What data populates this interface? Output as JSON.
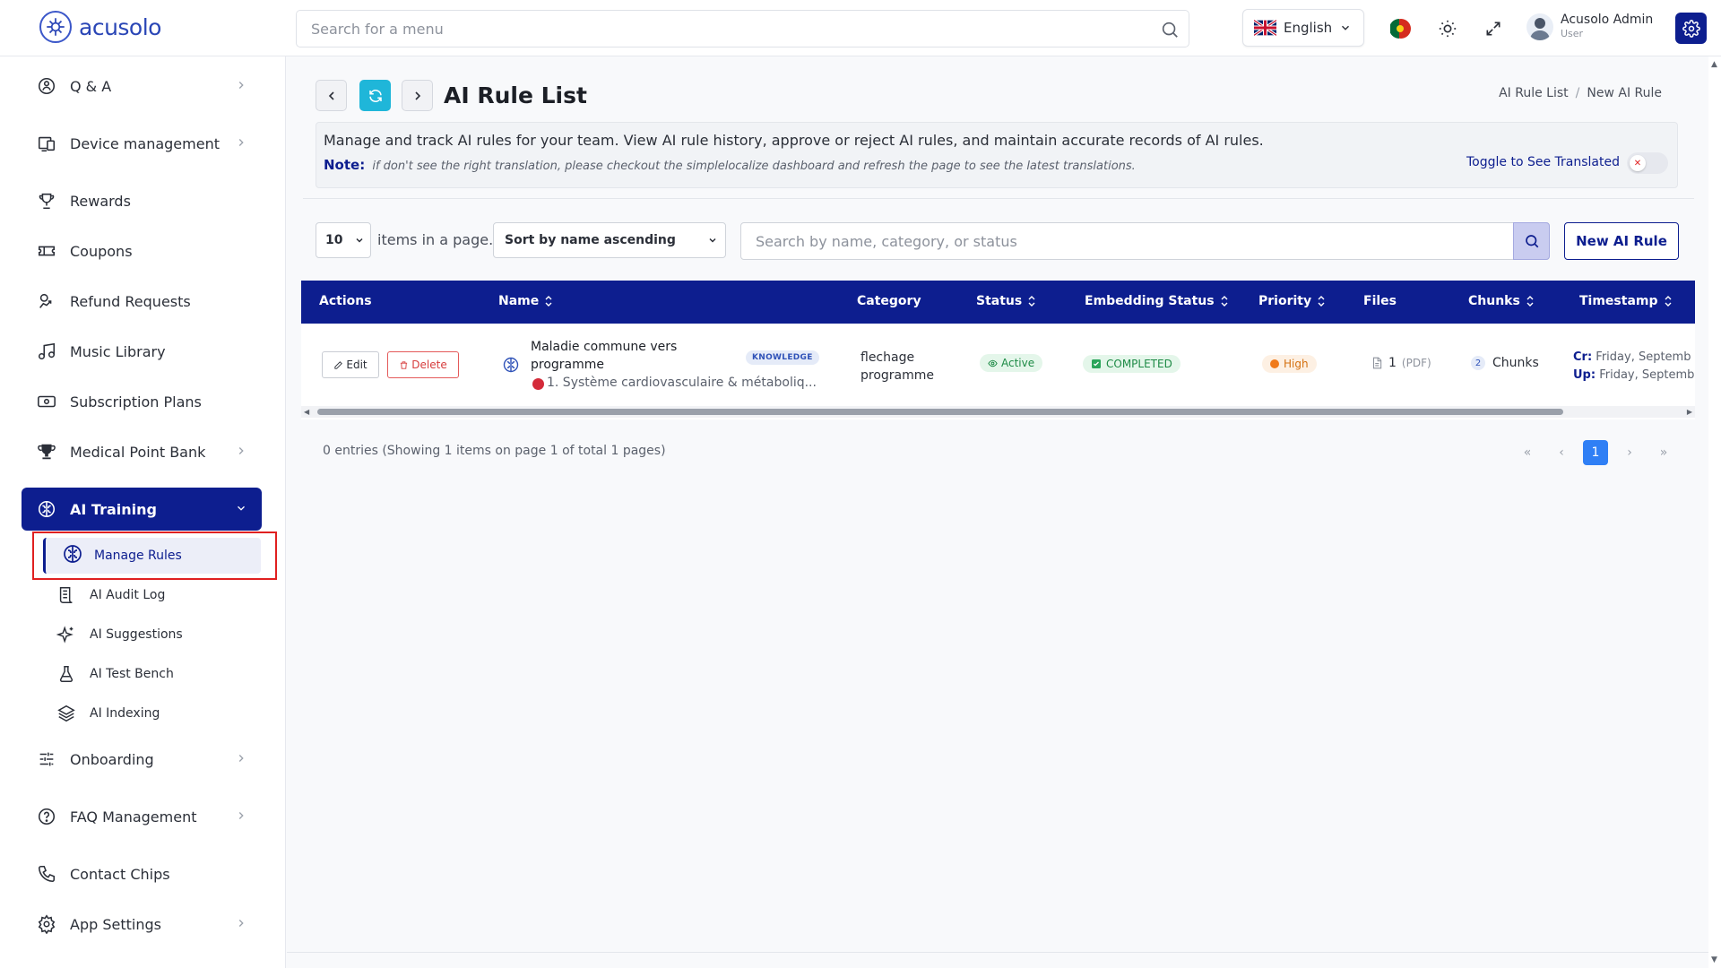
{
  "header": {
    "logo_text": "acusolo",
    "search_placeholder": "Search for a menu",
    "language": "English",
    "user_name": "Acusolo Admin",
    "user_role": "User"
  },
  "sidebar": {
    "items": [
      {
        "label": "Q & A",
        "icon": "people-icon",
        "has_chevron": true
      },
      {
        "label": "Device management",
        "icon": "devices-icon",
        "has_chevron": true
      },
      {
        "label": "Rewards",
        "icon": "trophy-icon",
        "has_chevron": false
      },
      {
        "label": "Coupons",
        "icon": "ticket-icon",
        "has_chevron": false
      },
      {
        "label": "Refund Requests",
        "icon": "refund-icon",
        "has_chevron": false
      },
      {
        "label": "Music Library",
        "icon": "music-icon",
        "has_chevron": false
      },
      {
        "label": "Subscription Plans",
        "icon": "money-icon",
        "has_chevron": false
      },
      {
        "label": "Medical Point Bank",
        "icon": "trophy-icon",
        "has_chevron": true
      },
      {
        "label": "AI Training",
        "icon": "brain-icon",
        "has_chevron": true,
        "active": true
      },
      {
        "label": "Onboarding",
        "icon": "sliders-icon",
        "has_chevron": true
      },
      {
        "label": "FAQ Management",
        "icon": "question-icon",
        "has_chevron": true
      },
      {
        "label": "Contact Chips",
        "icon": "phone-icon",
        "has_chevron": false
      },
      {
        "label": "App Settings",
        "icon": "gear-icon",
        "has_chevron": true
      }
    ],
    "ai_training_sub": [
      {
        "label": "Manage Rules",
        "icon": "brain-icon",
        "active": true
      },
      {
        "label": "AI Audit Log",
        "icon": "scroll-icon"
      },
      {
        "label": "AI Suggestions",
        "icon": "sparkles-icon"
      },
      {
        "label": "AI Test Bench",
        "icon": "flask-icon"
      },
      {
        "label": "AI Indexing",
        "icon": "layers-icon"
      }
    ]
  },
  "page": {
    "title": "AI Rule List",
    "breadcrumb": [
      "AI Rule List",
      "New AI Rule"
    ],
    "description": "Manage and track AI rules for your team. View AI rule history, approve or reject AI rules, and maintain accurate records of AI rules.",
    "note_label": "Note:",
    "note_text": "if don't see the right translation, please checkout the simplelocalize dashboard and refresh the page to see the latest translations.",
    "toggle_label": "Toggle to See Translated"
  },
  "controls": {
    "per_page": "10",
    "items_label": "items in a page.",
    "sort": "Sort by name ascending",
    "search_placeholder": "Search by name, category, or status",
    "new_button": "New AI Rule"
  },
  "table": {
    "columns": [
      "Actions",
      "Name",
      "Category",
      "Status",
      "Embedding Status",
      "Priority",
      "Files",
      "Chunks",
      "Timestamp"
    ],
    "rows": [
      {
        "edit": "Edit",
        "delete": "Delete",
        "name": "Maladie commune vers programme",
        "badge": "KNOWLEDGE",
        "sub": "1. Système cardiovasculaire & métaboliq...",
        "category": "flechage programme",
        "status": "Active",
        "embedding": "COMPLETED",
        "priority": "High",
        "files": "1",
        "files_type": "(PDF)",
        "chunks_num": "2",
        "chunks_label": "Chunks",
        "ts_created_label": "Cr:",
        "ts_created": "Friday, Septemb",
        "ts_updated_label": "Up:",
        "ts_updated": "Friday, Septemb"
      }
    ]
  },
  "footer": {
    "entries": "0 entries (Showing 1 items on page 1 of total 1 pages)",
    "current_page": "1"
  },
  "colors": {
    "primary": "#0d1e8f",
    "refresh": "#1fb6d9",
    "active_green": "#1d8a45",
    "high_orange": "#d4700f",
    "delete_red": "#d63c3c"
  }
}
